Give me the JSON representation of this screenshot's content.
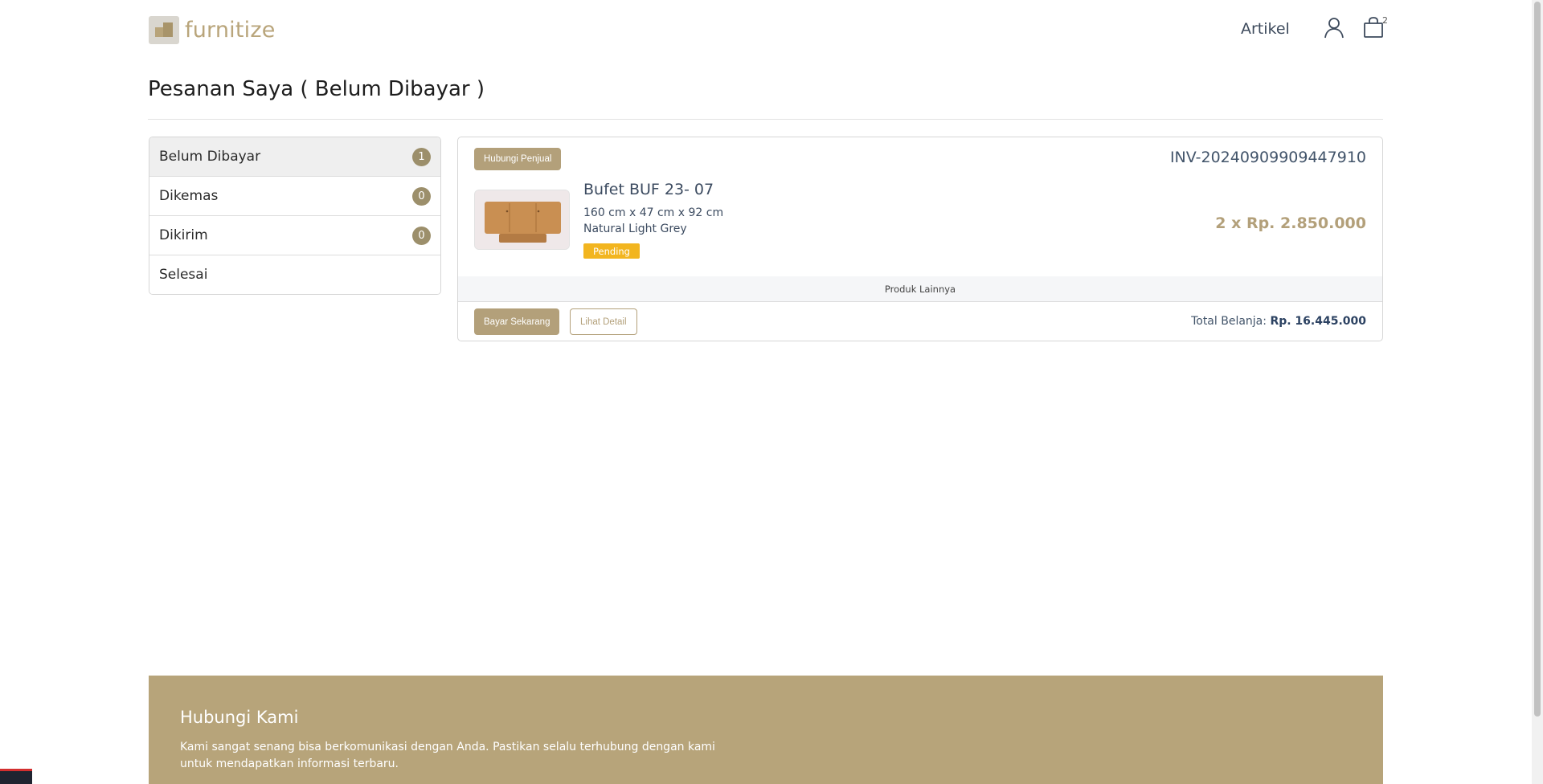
{
  "header": {
    "logo_text": "furnitize",
    "nav_link": "Artikel",
    "cart_count": "2"
  },
  "page": {
    "title": "Pesanan Saya ( Belum Dibayar )"
  },
  "sidebar": {
    "items": [
      {
        "label": "Belum Dibayar",
        "count": "1"
      },
      {
        "label": "Dikemas",
        "count": "0"
      },
      {
        "label": "Dikirim",
        "count": "0"
      },
      {
        "label": "Selesai",
        "count": ""
      }
    ]
  },
  "order": {
    "contact_label": "Hubungi Penjual",
    "invoice": "INV-20240909909447910",
    "product": {
      "name": "Bufet BUF 23- 07",
      "dimensions": "160 cm x 47 cm x 92 cm",
      "color": "Natural Light Grey",
      "status": "Pending",
      "price": "2 x Rp. 2.850.000"
    },
    "more_label": "Produk Lainnya",
    "pay_label": "Bayar Sekarang",
    "detail_label": "Lihat Detail",
    "total_label": "Total Belanja:",
    "total_value": "Rp. 16.445.000"
  },
  "footer": {
    "title": "Hubungi Kami",
    "text": "Kami sangat senang bisa berkomunikasi dengan Anda. Pastikan selalu terhubung dengan kami untuk mendapatkan informasi terbaru."
  },
  "colors": {
    "accent": "#b3a07a",
    "pending": "#f2b51f",
    "badge": "#9c8f6b"
  }
}
